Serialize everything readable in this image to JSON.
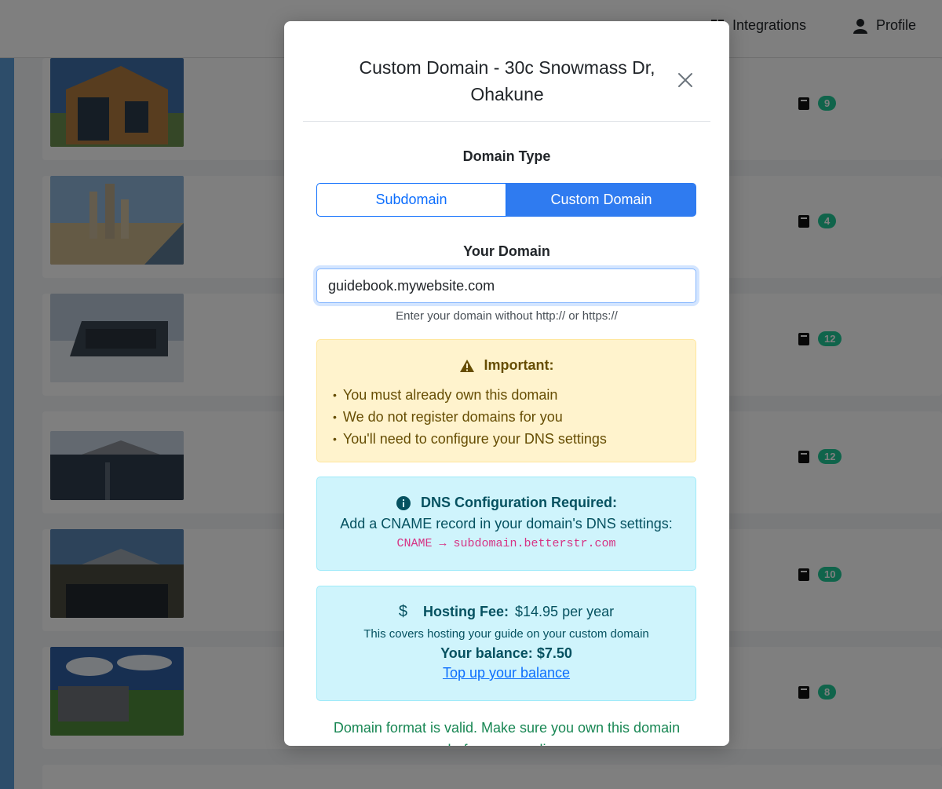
{
  "nav": {
    "integrations_label": "Integrations",
    "profile_label": "Profile"
  },
  "properties": [
    {
      "guide_count": "9"
    },
    {
      "guide_count": "4"
    },
    {
      "guide_count": "12"
    },
    {
      "guide_count": "12"
    },
    {
      "guide_count": "10"
    },
    {
      "guide_count": "8"
    }
  ],
  "modal": {
    "title": "Custom Domain - 30c Snowmass Dr, Ohakune",
    "domain_type_label": "Domain Type",
    "subdomain_label": "Subdomain",
    "custom_domain_label": "Custom Domain",
    "selected_type": "Custom Domain",
    "your_domain_label": "Your Domain",
    "domain_value": "guidebook.mywebsite.com",
    "domain_help": "Enter your domain without http:// or https://",
    "important": {
      "heading": "Important:",
      "items": [
        "You must already own this domain",
        "We do not register domains for you",
        "You'll need to configure your DNS settings"
      ]
    },
    "dns": {
      "heading": "DNS Configuration Required:",
      "instruction": "Add a CNAME record in your domain's DNS settings:",
      "record": "CNAME → subdomain.betterstr.com"
    },
    "hosting": {
      "fee_label": "Hosting Fee:",
      "fee_value": "$14.95 per year",
      "description": "This covers hosting your guide on your custom domain",
      "balance_label": "Your balance:",
      "balance_value": "$7.50",
      "top_up_link": "Top up your balance"
    },
    "validation_message": "Domain format is valid. Make sure you own this domain before proceeding."
  },
  "colors": {
    "primary": "#0d6efd",
    "toggle_active": "#2f7bf0",
    "warning_bg": "#fff3cd",
    "info_bg": "#cff4fc",
    "success_text": "#198754",
    "badge": "#20c997"
  },
  "icons": {
    "close": "close-icon",
    "warning": "warning-triangle-icon",
    "info": "info-circle-icon",
    "dollar": "dollar-icon",
    "guide": "book-icon",
    "integrations": "integrations-icon",
    "profile": "user-icon"
  }
}
